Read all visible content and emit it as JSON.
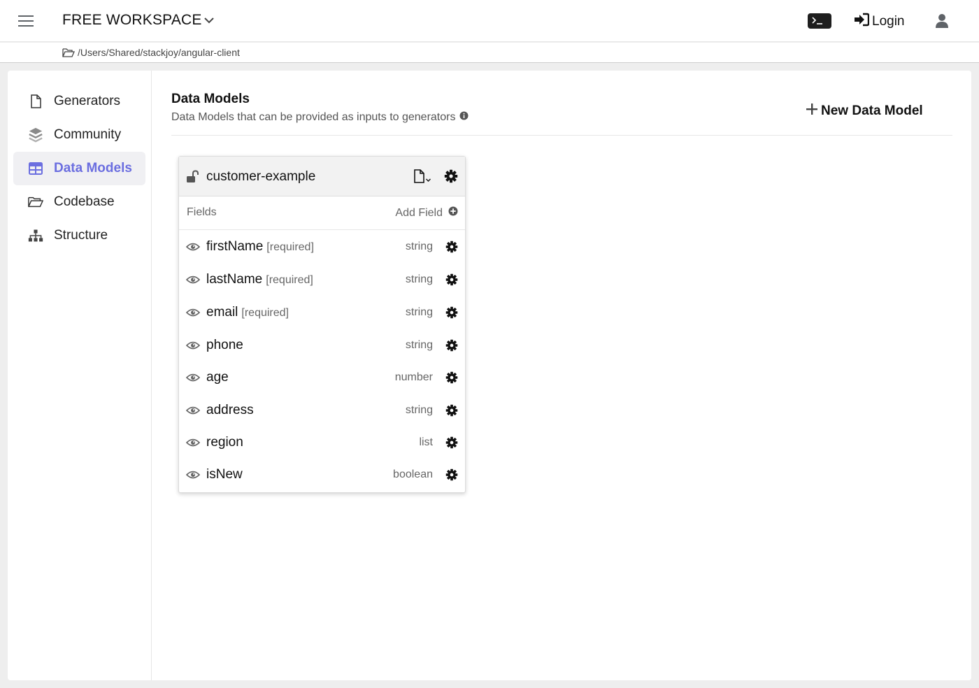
{
  "header": {
    "workspace_title": "FREE WORKSPACE",
    "login_label": "Login",
    "icons": [
      "menu-icon",
      "chevron-down-icon",
      "terminal-icon",
      "sign-in-icon",
      "user-icon"
    ]
  },
  "pathbar": {
    "path": "/Users/Shared/stackjoy/angular-client"
  },
  "sidebar": {
    "items": [
      {
        "label": "Generators",
        "icon": "file-icon",
        "active": false
      },
      {
        "label": "Community",
        "icon": "layers-icon",
        "active": false
      },
      {
        "label": "Data Models",
        "icon": "table-icon",
        "active": true
      },
      {
        "label": "Codebase",
        "icon": "folder-open-icon",
        "active": false
      },
      {
        "label": "Structure",
        "icon": "sitemap-icon",
        "active": false
      }
    ]
  },
  "main": {
    "title": "Data Models",
    "subtitle": "Data Models that can be provided as inputs to generators",
    "new_button_label": "New Data Model"
  },
  "model_card": {
    "name": "customer-example",
    "fields_label": "Fields",
    "add_field_label": "Add Field",
    "fields": [
      {
        "name": "firstName",
        "required": "[required]",
        "type": "string"
      },
      {
        "name": "lastName",
        "required": "[required]",
        "type": "string"
      },
      {
        "name": "email",
        "required": "[required]",
        "type": "string"
      },
      {
        "name": "phone",
        "required": "",
        "type": "string"
      },
      {
        "name": "age",
        "required": "",
        "type": "number"
      },
      {
        "name": "address",
        "required": "",
        "type": "string"
      },
      {
        "name": "region",
        "required": "",
        "type": "list"
      },
      {
        "name": "isNew",
        "required": "",
        "type": "boolean"
      }
    ]
  },
  "colors": {
    "accent": "#6b6ee0",
    "text": "#111111",
    "muted": "#666666",
    "background": "#eeeeee"
  }
}
